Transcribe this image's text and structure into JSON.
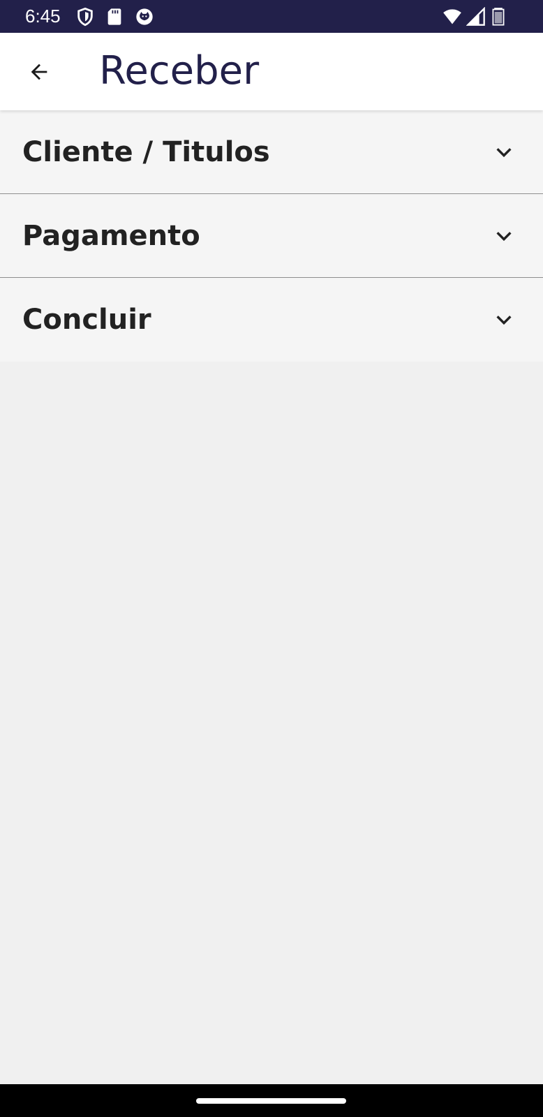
{
  "status_bar": {
    "time": "6:45",
    "icons_left": [
      "shield-icon",
      "sd-card-icon",
      "cat-face-icon"
    ],
    "icons_right": [
      "wifi-icon",
      "cell-signal-icon",
      "battery-icon"
    ],
    "background": "#22204a"
  },
  "app_bar": {
    "title": "Receber",
    "back_icon": "arrow-back-icon",
    "title_color": "#22204a"
  },
  "sections": [
    {
      "label": "Cliente / Titulos",
      "expanded": false
    },
    {
      "label": "Pagamento",
      "expanded": false
    },
    {
      "label": "Concluir",
      "expanded": false
    }
  ]
}
